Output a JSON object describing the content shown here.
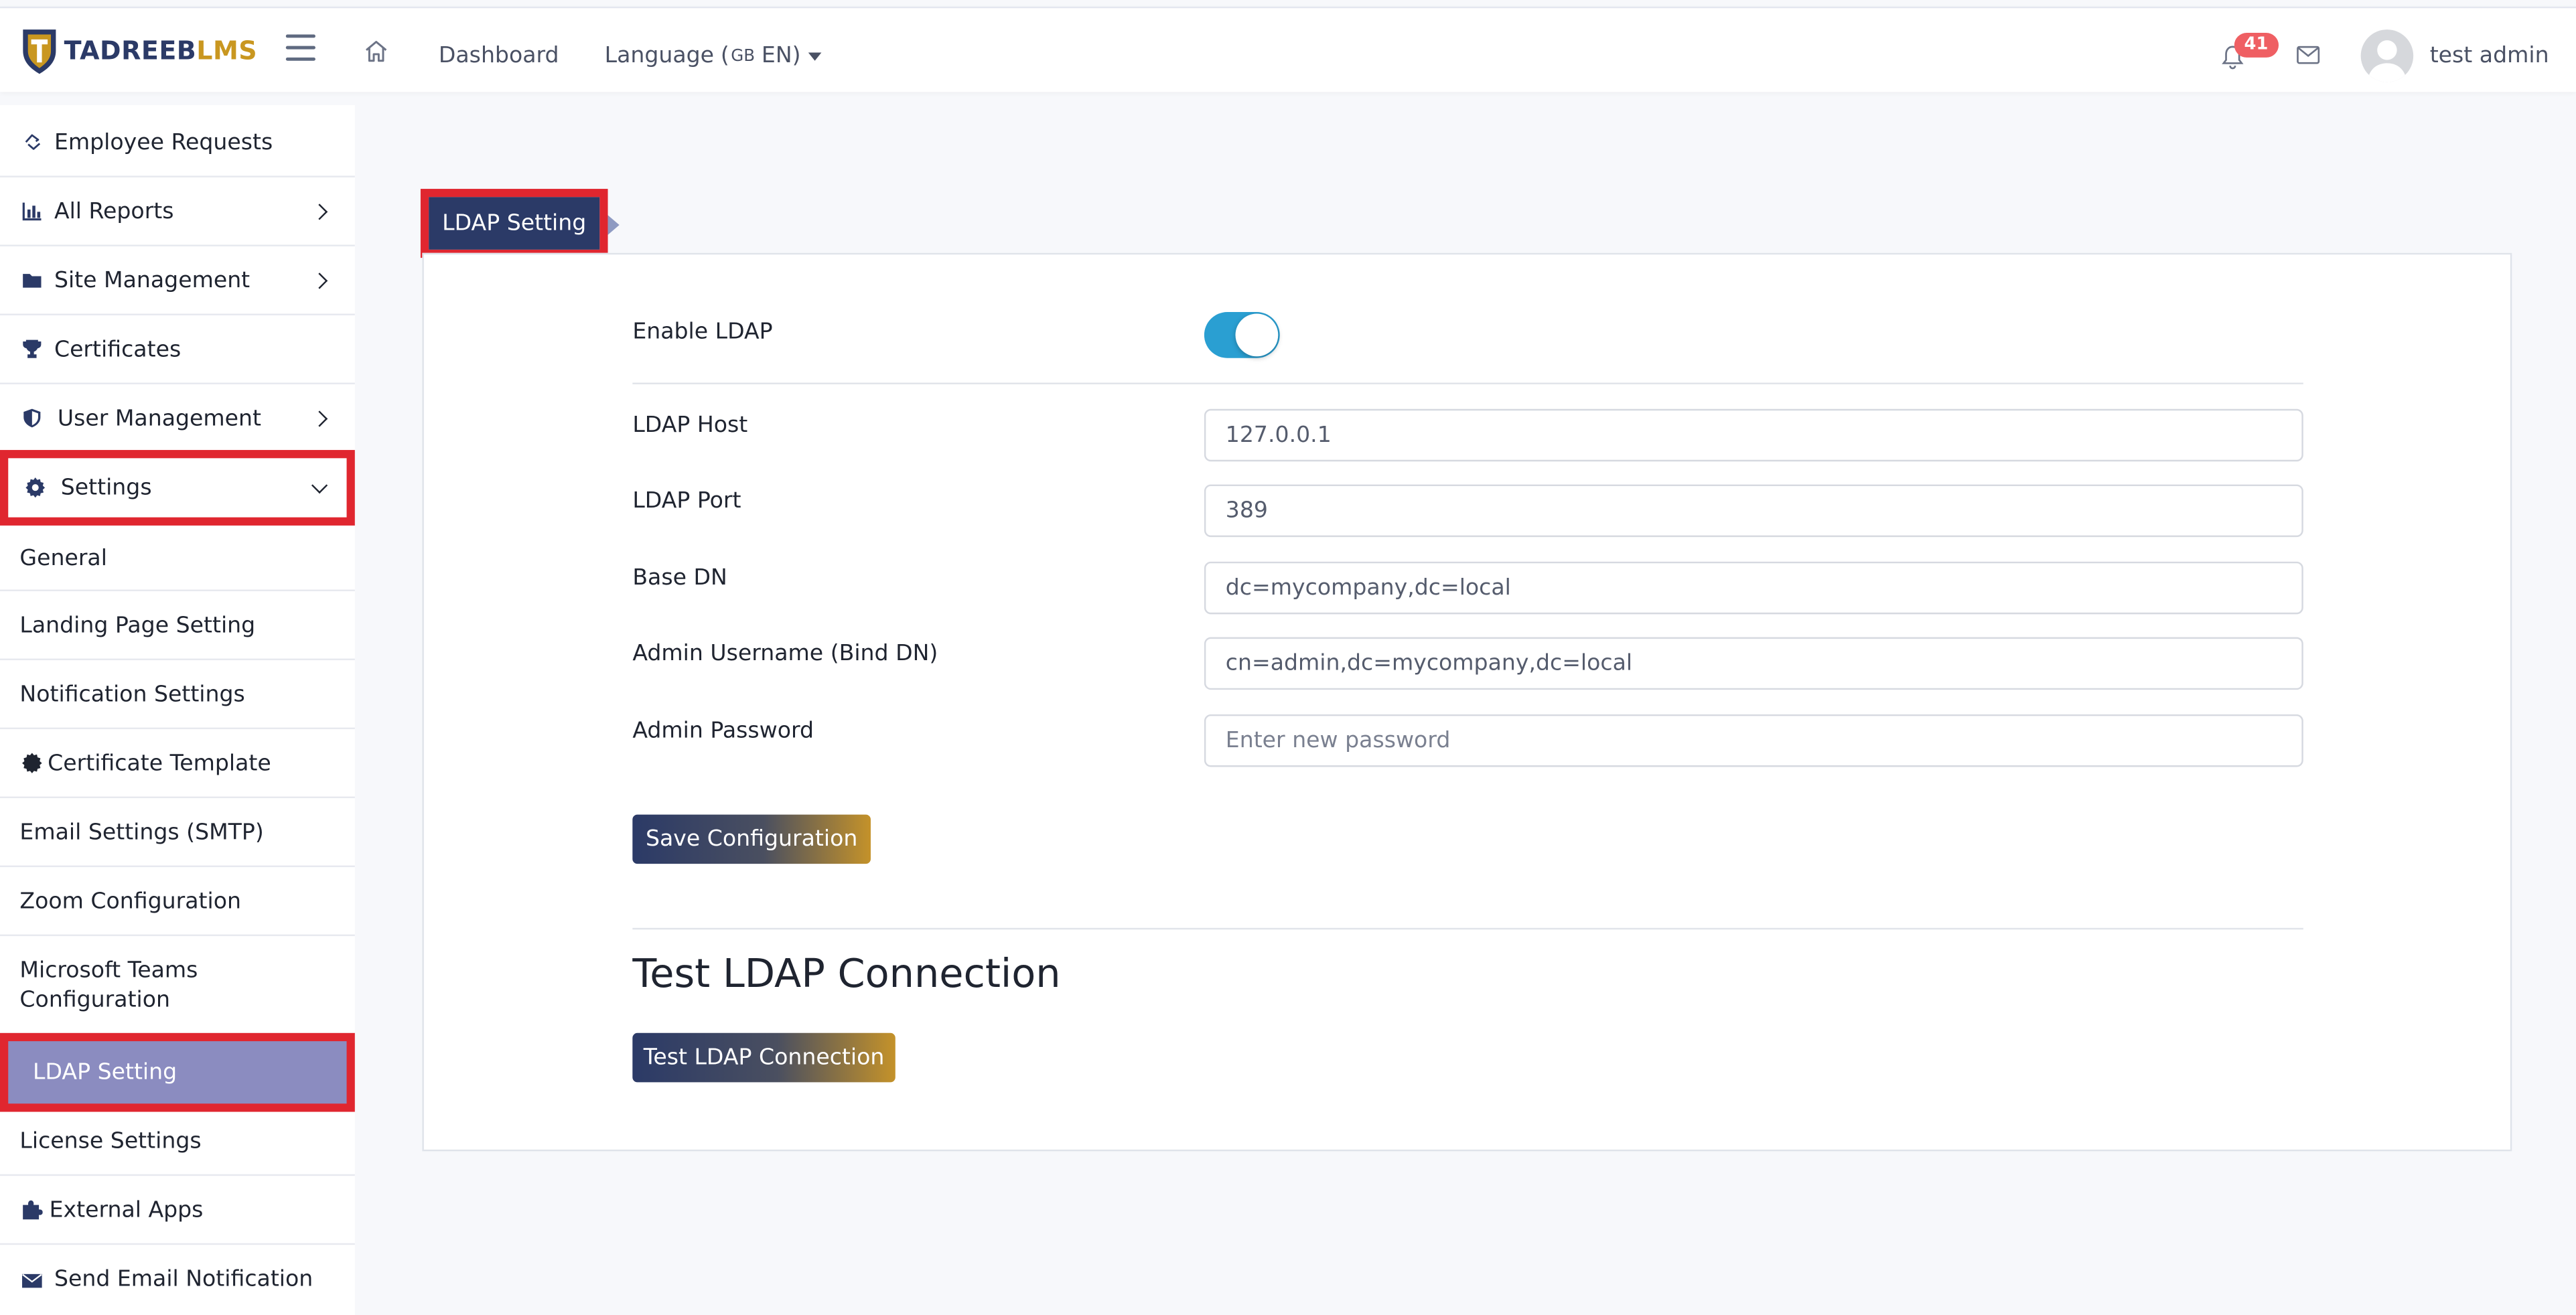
{
  "topbar": {
    "logo_main": "TADREEB",
    "logo_accent": "LMS",
    "nav_dashboard": "Dashboard",
    "nav_language": "Language",
    "language_flag": "GB",
    "language_code": "EN",
    "notification_count": "41",
    "user_name": "test admin"
  },
  "sidebar": {
    "items": [
      {
        "label": "Employee Requests",
        "icon": "hand-icon"
      },
      {
        "label": "All Reports",
        "icon": "bar-chart-icon"
      },
      {
        "label": "Site Management",
        "icon": "folder-icon"
      },
      {
        "label": "Certificates",
        "icon": "trophy-icon"
      },
      {
        "label": "User Management",
        "icon": "shield-icon"
      },
      {
        "label": "Settings",
        "icon": "gear-icon"
      },
      {
        "label": "General"
      },
      {
        "label": "Landing Page Setting"
      },
      {
        "label": "Notification Settings"
      },
      {
        "label": "Certificate Template",
        "icon": "certificate-icon"
      },
      {
        "label": "Email Settings (SMTP)"
      },
      {
        "label": "Zoom Configuration"
      },
      {
        "label": "Microsoft Teams Configuration"
      },
      {
        "label": "LDAP Setting"
      },
      {
        "label": "License Settings"
      },
      {
        "label": "External Apps",
        "icon": "puzzle-icon"
      },
      {
        "label": "Send Email Notification",
        "icon": "envelope-icon"
      }
    ]
  },
  "main": {
    "tab_label": "LDAP Setting",
    "form": {
      "enable_label": "Enable LDAP",
      "enable_value": "on",
      "host_label": "LDAP Host",
      "host_value": "127.0.0.1",
      "port_label": "LDAP Port",
      "port_value": "389",
      "base_dn_label": "Base DN",
      "base_dn_value": "dc=mycompany,dc=local",
      "admin_user_label": "Admin Username (Bind DN)",
      "admin_user_value": "cn=admin,dc=mycompany,dc=local",
      "admin_pass_label": "Admin Password",
      "admin_pass_placeholder": "Enter new password",
      "save_button": "Save Configuration"
    },
    "test_heading": "Test LDAP Connection",
    "test_button": "Test LDAP Connection"
  },
  "colors": {
    "brand_navy": "#2b3a67",
    "brand_gold": "#c4922a",
    "highlight_red": "#e0262f",
    "toggle_on": "#2a9fd2",
    "active_item": "#8b8cc0",
    "badge": "#ef5f63"
  }
}
